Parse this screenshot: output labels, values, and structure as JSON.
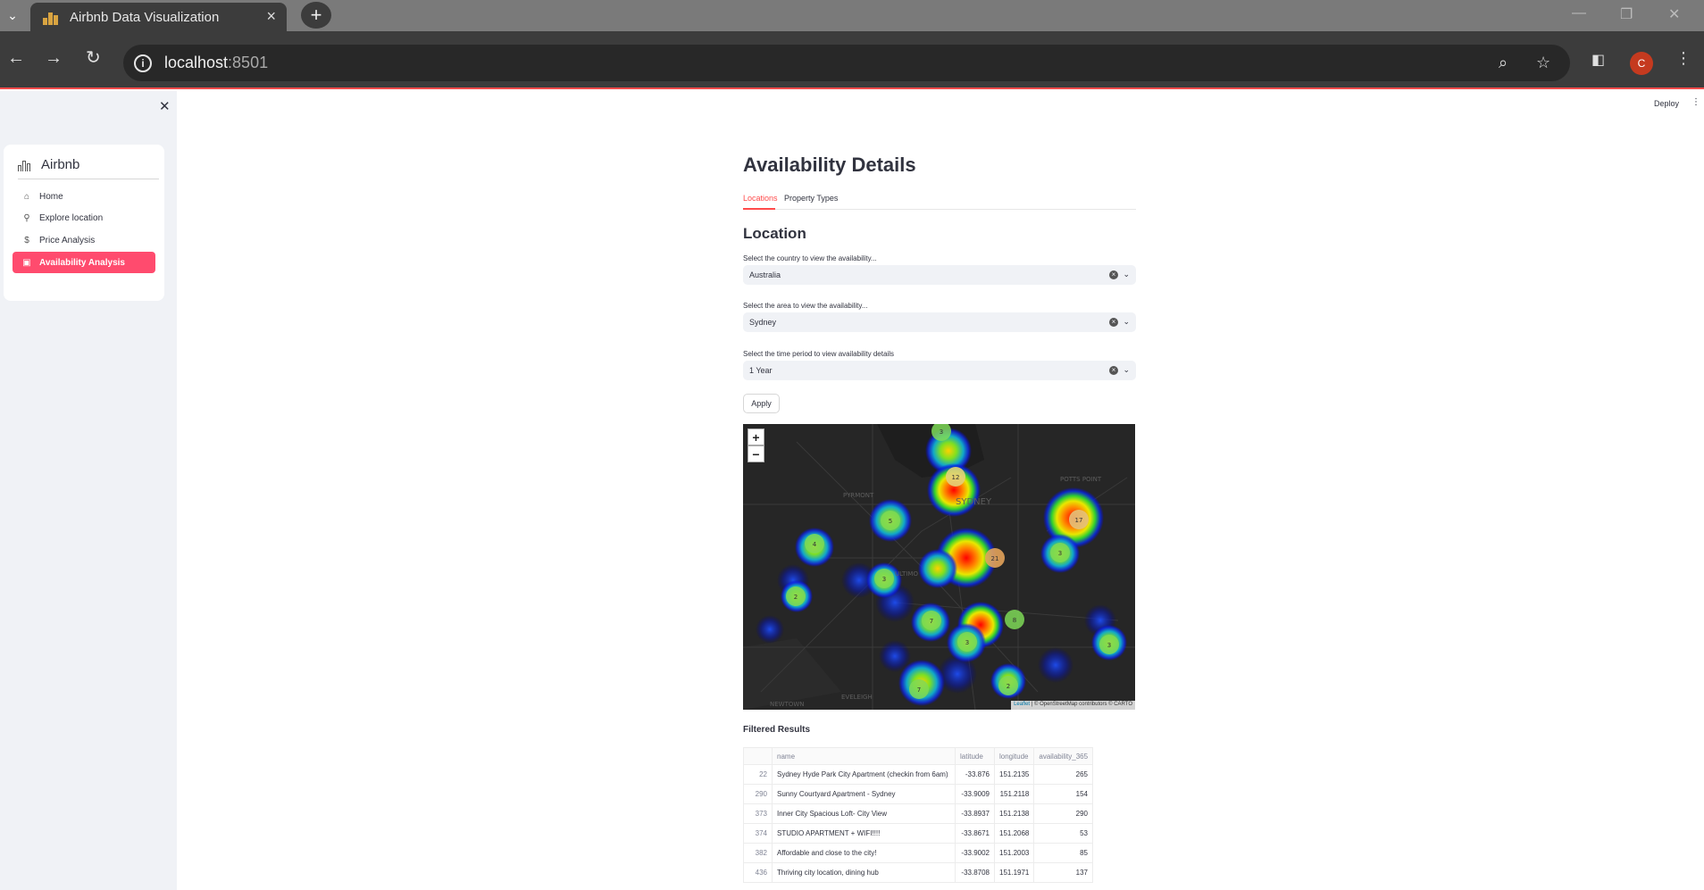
{
  "browser": {
    "tab_title": "Airbnb Data Visualization",
    "url_host": "localhost",
    "url_port": ":8501",
    "profile_initial": "C"
  },
  "sidebar": {
    "app_name": "Airbnb",
    "items": [
      {
        "label": "Home",
        "icon": "home-icon"
      },
      {
        "label": "Explore location",
        "icon": "search-icon"
      },
      {
        "label": "Price Analysis",
        "icon": "dollar-icon"
      },
      {
        "label": "Availability Analysis",
        "icon": "calendar-icon",
        "active": true
      }
    ]
  },
  "header": {
    "deploy_label": "Deploy"
  },
  "main": {
    "title": "Availability Details",
    "tabs": [
      {
        "label": "Locations",
        "active": true
      },
      {
        "label": "Property Types",
        "active": false
      }
    ],
    "section_title": "Location",
    "filters": {
      "country_label": "Select the country to view the availability...",
      "country_value": "Australia",
      "area_label": "Select the area to view the availability...",
      "area_value": "Sydney",
      "period_label": "Select the time period to view availability details",
      "period_value": "1 Year"
    },
    "apply_label": "Apply",
    "map": {
      "zoom_in": "+",
      "zoom_out": "−",
      "attribution_leaflet": "Leaflet",
      "attribution_osm": "© OpenStreetMap contributors © CARTO",
      "place_labels": [
        "PYRMONT",
        "SYDNEY",
        "POTTS POINT",
        "ULTIMO",
        "NEWTOWN",
        "EVELEIGH"
      ],
      "cluster_counts": [
        "3",
        "12",
        "5",
        "17",
        "4",
        "21",
        "3",
        "3",
        "2",
        "7",
        "8",
        "3",
        "3",
        "7",
        "2"
      ]
    },
    "results_title": "Filtered Results",
    "table": {
      "columns": [
        "",
        "name",
        "latitude",
        "longitude",
        "availability_365"
      ],
      "rows": [
        [
          "22",
          "Sydney Hyde Park City Apartment (checkin from 6am)",
          "-33.876",
          "151.2135",
          "265"
        ],
        [
          "290",
          "Sunny Courtyard Apartment - Sydney",
          "-33.9009",
          "151.2118",
          "154"
        ],
        [
          "373",
          "Inner City Spacious Loft- City View",
          "-33.8937",
          "151.2138",
          "290"
        ],
        [
          "374",
          "STUDIO APARTMENT + WIFI!!!!",
          "-33.8671",
          "151.2068",
          "53"
        ],
        [
          "382",
          "Affordable and close to the city!",
          "-33.9002",
          "151.2003",
          "85"
        ],
        [
          "436",
          "Thriving city location, dining hub",
          "-33.8708",
          "151.1971",
          "137"
        ]
      ]
    }
  }
}
